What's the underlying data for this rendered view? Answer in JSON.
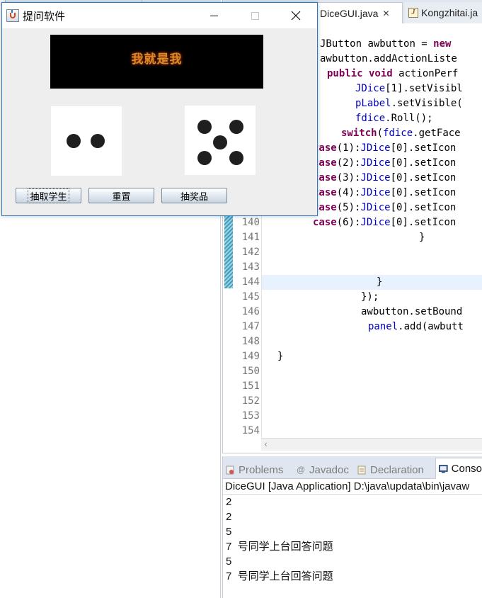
{
  "app_window": {
    "title": "提问软件",
    "banner_text": "我就是我",
    "dice": [
      {
        "face": 2
      },
      {
        "face": 5
      }
    ],
    "buttons": {
      "draw_student": "抽取学生",
      "reset": "重置",
      "draw_prize": "抽奖品"
    }
  },
  "editor": {
    "tabs": [
      {
        "label": "DiceGUI.java"
      },
      {
        "label": "Kongzhitai.ja"
      }
    ],
    "line_numbers": [
      "140",
      "141",
      "142",
      "143",
      "144",
      "145",
      "146",
      "147",
      "148",
      "149",
      "150",
      "151",
      "152",
      "153",
      "154"
    ],
    "code_lines": {
      "l1_cls": "JButton",
      "l1_var": " awbutton = ",
      "l1_kw": "new",
      "l2": "awbutton.addActionListe",
      "l3_kw": "public void",
      "l3_rest": " actionPerf",
      "l4_fld": "JDice",
      "l4_rest": "[1].setVisibl",
      "l5_fld": "pLabel",
      "l5_rest": ".setVisible(",
      "l6_fld": "fdice",
      "l6_rest": ".Roll();",
      "l7_kw": "switch",
      "l7_open": "(",
      "l7_fld": "fdice",
      "l7_rest": ".getFace",
      "case1_kw": "case",
      "case1_num": "(1):",
      "case1_fld": "JDice",
      "case1_rest": "[0].setIcon",
      "case2_kw": "case",
      "case2_num": "(2):",
      "case2_fld": "JDice",
      "case2_rest": "[0].setIcon",
      "case3_kw": "case",
      "case3_num": "(3):",
      "case3_fld": "JDice",
      "case3_rest": "[0].setIcon",
      "case4_kw": "case",
      "case4_num": "(4):",
      "case4_fld": "JDice",
      "case4_rest": "[0].setIcon",
      "case5_kw": "case",
      "case5_num": "(5):",
      "case5_fld": "JDice",
      "case5_rest": "[0].setIcon",
      "case6_kw": "case",
      "case6_num": "(6):",
      "case6_fld": "JDice",
      "case6_rest": "[0].setIcon",
      "brace1": "}",
      "brace2": "}",
      "close_paren": "});",
      "setbounds": "awbutton.setBound",
      "panel_fld": "panel",
      "panel_rest": ".add(awbutt",
      "brace3": "}"
    }
  },
  "console": {
    "tabs": [
      {
        "label": "Problems"
      },
      {
        "label": "Javadoc"
      },
      {
        "label": "Declaration"
      },
      {
        "label": "Conso"
      }
    ],
    "header": "DiceGUI [Java Application] D:\\java\\updata\\bin\\javaw",
    "lines": [
      "2",
      "2",
      "5",
      "7  号同学上台回答问题",
      "5",
      "7  号同学上台回答问题"
    ]
  }
}
